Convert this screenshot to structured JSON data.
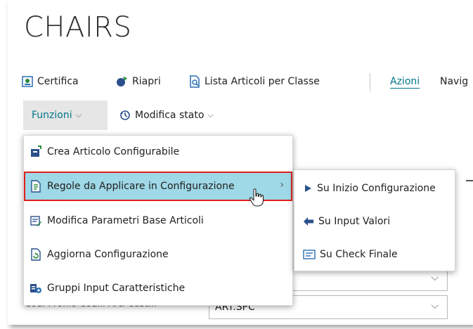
{
  "page": {
    "title": "CHAIRS"
  },
  "actions": {
    "certifica": "Certifica",
    "riapri": "Riapri",
    "lista_articoli": "Lista Articoli per Classe",
    "azioni": "Azioni",
    "navigate": "Navig"
  },
  "subactions": {
    "funzioni": "Funzioni",
    "modifica_stato": "Modifica stato"
  },
  "menu": {
    "items": [
      {
        "label": "Crea Articolo Configurabile",
        "icon": "configurable-item-icon"
      },
      {
        "label": "Regole da Applicare in Configurazione",
        "icon": "rules-icon",
        "highlighted": true
      },
      {
        "label": "Modifica Parametri Base Articoli",
        "icon": "edit-parameters-icon"
      },
      {
        "label": "Aggiorna Configurazione",
        "icon": "refresh-document-icon"
      },
      {
        "label": "Gruppi Input Caratteristiche",
        "icon": "group-input-icon"
      }
    ]
  },
  "submenu": {
    "items": [
      {
        "label": "Su Inizio Configurazione",
        "icon": "play-icon"
      },
      {
        "label": "Su Input Valori",
        "icon": "arrow-left-icon"
      },
      {
        "label": "Su Check Finale",
        "icon": "check-list-icon"
      }
    ]
  },
  "form": {
    "profile_label": "Cod. Profilo Codif. Art. Cust...",
    "profile_value": "ART.SPC"
  },
  "colors": {
    "accent": "#00758a",
    "highlight": "#9fd8e6",
    "highlight_border": "#e0201b"
  }
}
